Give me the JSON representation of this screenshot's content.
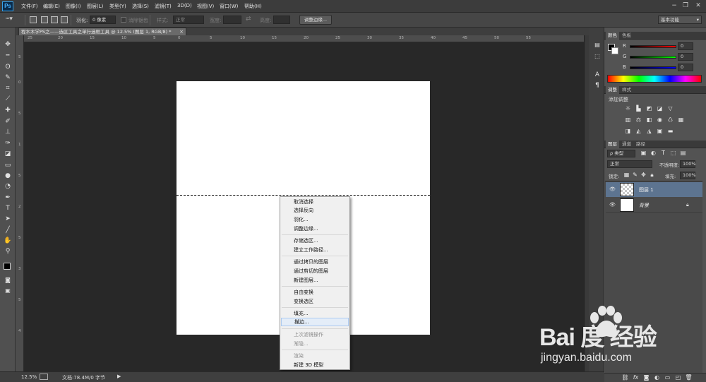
{
  "app": {
    "logo": "Ps"
  },
  "menu": [
    "文件(F)",
    "编辑(E)",
    "图像(I)",
    "图层(L)",
    "类型(Y)",
    "选择(S)",
    "滤镜(T)",
    "3D(D)",
    "视图(V)",
    "窗口(W)",
    "帮助(H)"
  ],
  "window_controls": {
    "minimize": "−",
    "restore": "❐",
    "close": "✕"
  },
  "options": {
    "feather_label": "羽化:",
    "feather_value": "0 像素",
    "antialias_label": "消除锯齿",
    "style_label": "样式:",
    "style_value": "正常",
    "width_label": "宽度:",
    "height_label": "高度:",
    "refine_edge": "调整边缘...",
    "workspace": "基本功能"
  },
  "document": {
    "tab_title": "程木木学PS之——选区工具之单行选框工具 @ 12.5% (图层 1, RGB/8) *",
    "tab_close": "×"
  },
  "rulers": {
    "h": [
      "25",
      "20",
      "15",
      "10",
      "5",
      "0",
      "5",
      "10",
      "15",
      "20",
      "25",
      "30",
      "35",
      "40",
      "45",
      "50",
      "55"
    ],
    "v": [
      "5",
      "0",
      "5",
      "1",
      "5",
      "2",
      "5",
      "3",
      "5",
      "4"
    ]
  },
  "context_menu": {
    "items": [
      {
        "label": "取消选择",
        "disabled": false
      },
      {
        "label": "选择反向",
        "disabled": false
      },
      {
        "label": "羽化...",
        "disabled": false
      },
      {
        "label": "调整边缘...",
        "disabled": false
      },
      {
        "label": "存储选区...",
        "disabled": false
      },
      {
        "label": "建立工作路径...",
        "disabled": false
      },
      {
        "label": "通过拷贝的图层",
        "disabled": false
      },
      {
        "label": "通过剪切的图层",
        "disabled": false
      },
      {
        "label": "新建图层...",
        "disabled": false
      },
      {
        "label": "自由变换",
        "disabled": false
      },
      {
        "label": "变换选区",
        "disabled": false
      },
      {
        "label": "填充...",
        "disabled": false
      },
      {
        "label": "描边...",
        "disabled": false,
        "highlighted": true
      },
      {
        "label": "上次滤镜操作",
        "disabled": true
      },
      {
        "label": "渐隐...",
        "disabled": true
      },
      {
        "label": "渲染",
        "disabled": true
      },
      {
        "label": "新建 3D 模型",
        "disabled": false
      }
    ]
  },
  "status": {
    "zoom": "12.5%",
    "doc_info": "文档:78.4M/0 字节",
    "arrow": "▶"
  },
  "color_panel": {
    "tabs": [
      "颜色",
      "色板"
    ],
    "r_label": "R",
    "r_value": "0",
    "g_label": "G",
    "g_value": "0",
    "b_label": "B",
    "b_value": "0"
  },
  "adjust_panel": {
    "tabs": [
      "调整",
      "样式"
    ],
    "add_label": "添加调整"
  },
  "layers_panel": {
    "tabs": [
      "图层",
      "通道",
      "路径"
    ],
    "kind_filter": "ρ 类型",
    "blend_mode": "正常",
    "opacity_label": "不透明度:",
    "opacity_value": "100%",
    "lock_label": "锁定:",
    "fill_label": "填充:",
    "fill_value": "100%",
    "layers": [
      {
        "name": "图层 1",
        "selected": true,
        "transparent": true
      },
      {
        "name": "背景",
        "selected": false,
        "transparent": false,
        "locked": true
      }
    ],
    "footer_icons": [
      "link-icon",
      "fx-icon",
      "mask-icon",
      "adjustment-icon",
      "group-icon",
      "new-layer-icon",
      "trash-icon"
    ]
  },
  "watermark": {
    "logo_text": "Bai 度 经验",
    "url": "jingyan.baidu.com"
  }
}
